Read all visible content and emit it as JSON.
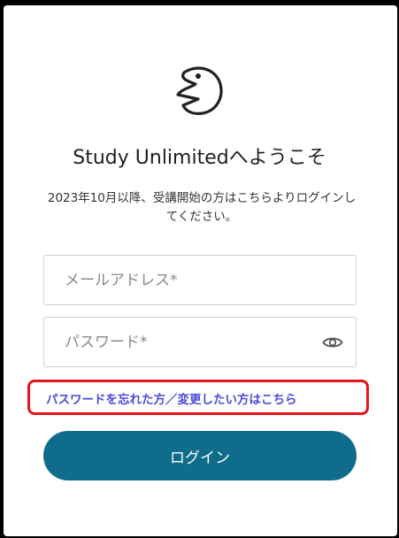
{
  "header": {
    "logo_icon": "pacman-face-icon",
    "title": "Study Unlimitedへようこそ"
  },
  "description": "2023年10月以降、受講開始の方はこちらよりログインしてください。",
  "form": {
    "email_placeholder": "メールアドレス*",
    "password_placeholder": "パスワード*",
    "password_toggle_icon": "eye-icon"
  },
  "forgot_link": "パスワードを忘れた方／変更したい方はこちら",
  "login_button": "ログイン",
  "colors": {
    "primary": "#0f6c8a",
    "link": "#4b4bd8",
    "highlight_border": "#e3141b"
  }
}
